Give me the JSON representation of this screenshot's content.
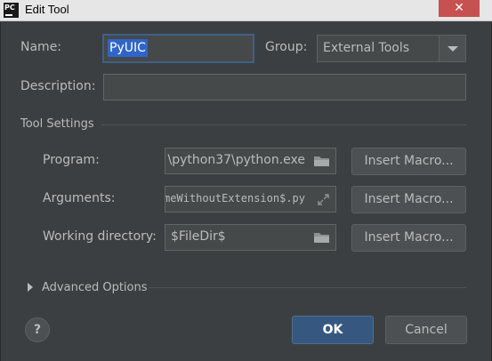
{
  "window": {
    "app_icon_text": "PC",
    "title": "Edit Tool",
    "close_glyph": "✕"
  },
  "form": {
    "name_label": "Name:",
    "name_value": "PyUIC",
    "group_label": "Group:",
    "group_value": "External Tools",
    "description_label": "Description:",
    "description_value": ""
  },
  "tool_settings": {
    "section_title": "Tool Settings",
    "program_label": "Program:",
    "program_value": "\\python37\\python.exe",
    "arguments_label": "Arguments:",
    "arguments_value": "meWithoutExtension$.py",
    "working_dir_label": "Working directory:",
    "working_dir_value": "$FileDir$",
    "insert_macro_label": "Insert Macro..."
  },
  "advanced": {
    "label": "Advanced Options"
  },
  "footer": {
    "help_glyph": "?",
    "ok_label": "OK",
    "cancel_label": "Cancel"
  },
  "colors": {
    "background": "#3c3f41",
    "field": "#45494a",
    "selection": "#2f65ca",
    "primary_button": "#365880",
    "close_button": "#c75050"
  },
  "icons": [
    "folder-icon",
    "expand-icon",
    "dropdown-arrow-icon",
    "help-icon",
    "chevron-right-icon",
    "close-icon",
    "pycharm-app-icon"
  ]
}
